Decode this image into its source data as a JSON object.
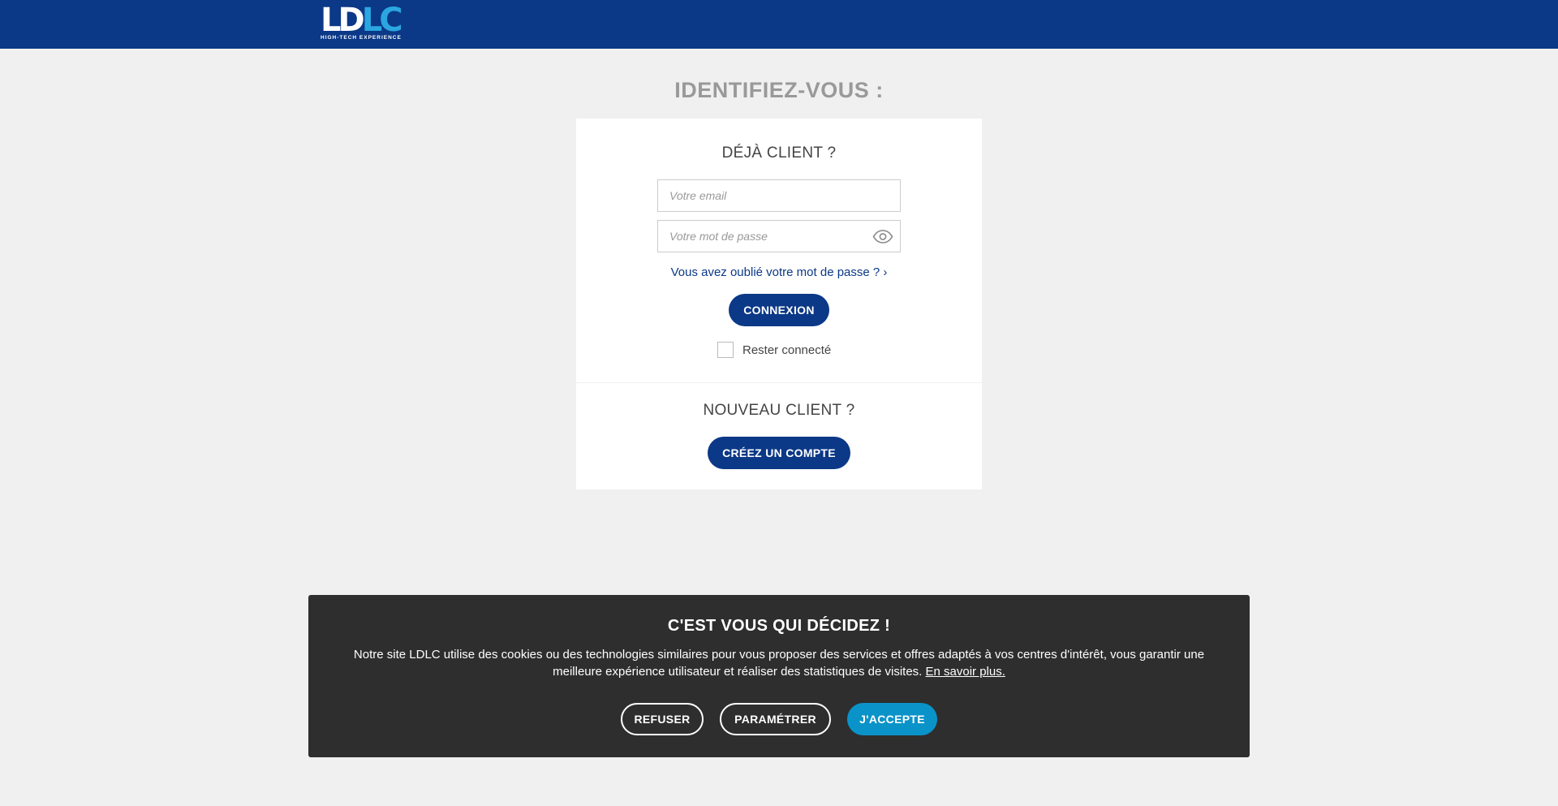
{
  "header": {
    "logo": {
      "part1": "LD",
      "part2": "LC",
      "tagline_start": "HIGH-TECH",
      "tagline_accent": "EXPERIENCE"
    },
    "colors": {
      "bar": "#0b3887",
      "logo_accent": "#2ba6e0"
    }
  },
  "page": {
    "title": "IDENTIFIEZ-VOUS :"
  },
  "login": {
    "title": "DÉJÀ CLIENT ?",
    "email_placeholder": "Votre email",
    "email_value": "",
    "password_placeholder": "Votre mot de passe",
    "password_value": "",
    "show_password_icon": "eye-icon",
    "forgot_link": "Vous avez oublié votre mot de passe ? ›",
    "submit_label": "CONNEXION",
    "remember_label": "Rester connecté",
    "remember_checked": false
  },
  "signup": {
    "title": "NOUVEAU CLIENT ?",
    "button_label": "CRÉEZ UN COMPTE"
  },
  "cookie_banner": {
    "title": "C'EST VOUS QUI DÉCIDEZ !",
    "text": "Notre site LDLC utilise des cookies ou des technologies similaires pour vous proposer des services et offres adaptés à vos centres d'intérêt, vous garantir une meilleure expérience utilisateur et réaliser des statistiques de visites.",
    "link": "En savoir plus.",
    "refuse_label": "REFUSER",
    "settings_label": "PARAMÉTRER",
    "accept_label": "J'ACCEPTE",
    "colors": {
      "background": "#2e2e2e",
      "accept": "#0a93c9"
    }
  }
}
